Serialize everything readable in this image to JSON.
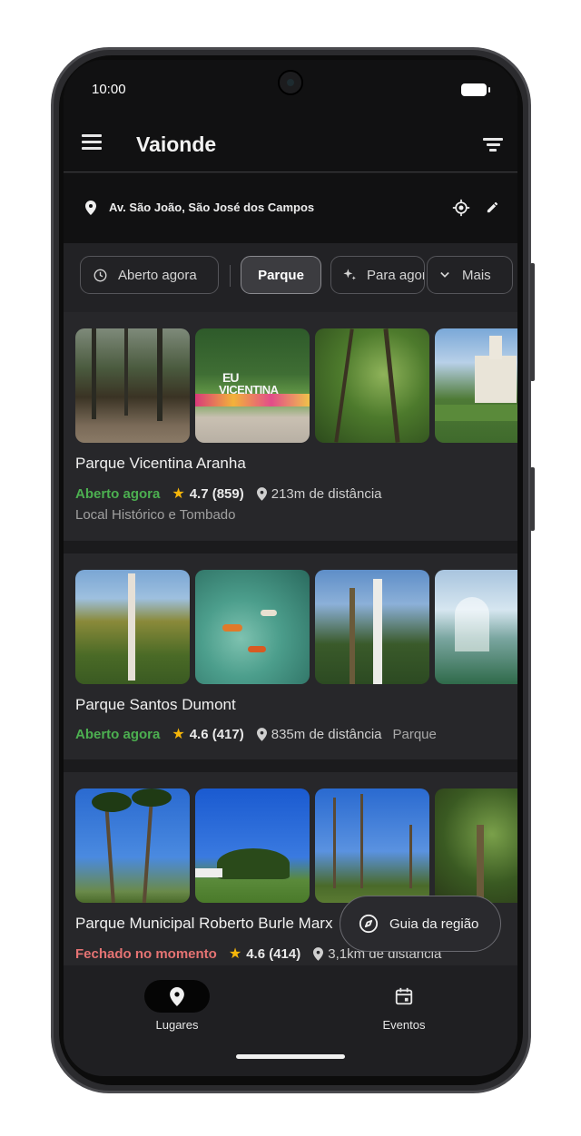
{
  "status_bar": {
    "time": "10:00"
  },
  "app_bar": {
    "title": "Vaionde",
    "menu_icon": "menu-icon",
    "filter_icon": "filter-icon"
  },
  "location": {
    "address": "Av. São João, São José dos Campos"
  },
  "chips": [
    {
      "label": "Aberto agora",
      "icon": "clock-icon",
      "selected": false
    },
    {
      "label": "Parque",
      "selected": true
    },
    {
      "label": "Para agora",
      "icon": "sparkle-icon",
      "selected": false
    },
    {
      "label": "Mais",
      "icon": "chevron-down-icon",
      "selected": false
    }
  ],
  "places": [
    {
      "name": "Parque Vicentina Aranha",
      "status": "Aberto agora",
      "status_color": "#4caf50",
      "rating": "4.7 (859)",
      "distance": "213m de distância",
      "category": "Local Histórico e Tombado",
      "photo_texts": [
        "EU",
        "VICENTINA"
      ]
    },
    {
      "name": "Parque Santos Dumont",
      "status": "Aberto agora",
      "status_color": "#4caf50",
      "rating": "4.6 (417)",
      "distance": "835m de distância",
      "category": "Parque"
    },
    {
      "name": "Parque Municipal Roberto Burle Marx",
      "status": "Fechado no momento",
      "status_color": "#e57373",
      "rating": "4.6 (414)",
      "distance": "3,1km de distância"
    }
  ],
  "fab": {
    "label": "Guia da região",
    "icon": "compass-icon"
  },
  "bottom_nav": [
    {
      "label": "Lugares",
      "icon": "pin-icon",
      "active": true
    },
    {
      "label": "Eventos",
      "icon": "calendar-icon",
      "active": false
    }
  ],
  "colors": {
    "background": "#1b1b1d",
    "card": "#27272a",
    "open": "#4caf50",
    "closed": "#e57373",
    "star": "#f6b60a"
  }
}
